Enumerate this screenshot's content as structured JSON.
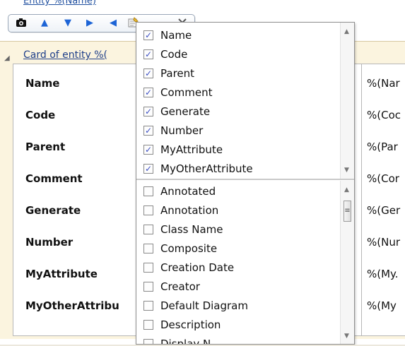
{
  "window": {
    "behind_title": "Entity %(Name)",
    "card_title": "Card of entity %("
  },
  "toolbar": {
    "icons": [
      "camera-icon",
      "arrow-up-icon",
      "arrow-down-icon",
      "arrow-right-icon",
      "arrow-left-icon",
      "properties-icon",
      "close-icon"
    ]
  },
  "card": {
    "rows": [
      {
        "label": "Name",
        "value": "%(Nar"
      },
      {
        "label": "Code",
        "value": "%(Coc"
      },
      {
        "label": "Parent",
        "value": "%(Par"
      },
      {
        "label": "Comment",
        "value": "%(Cor"
      },
      {
        "label": "Generate",
        "value": "%(Ger"
      },
      {
        "label": "Number",
        "value": "%(Nur"
      },
      {
        "label": "MyAttribute",
        "value": "%(My."
      },
      {
        "label": "MyOtherAttribu",
        "value": "%(My"
      }
    ]
  },
  "dropdown": {
    "top_items": [
      {
        "label": "Name",
        "checked": true
      },
      {
        "label": "Code",
        "checked": true
      },
      {
        "label": "Parent",
        "checked": true
      },
      {
        "label": "Comment",
        "checked": true
      },
      {
        "label": "Generate",
        "checked": true
      },
      {
        "label": "Number",
        "checked": true
      },
      {
        "label": "MyAttribute",
        "checked": true
      },
      {
        "label": "MyOtherAttribute",
        "checked": true
      }
    ],
    "bottom_items": [
      {
        "label": "Annotated",
        "checked": false
      },
      {
        "label": "Annotation",
        "checked": false
      },
      {
        "label": "Class Name",
        "checked": false
      },
      {
        "label": "Composite",
        "checked": false
      },
      {
        "label": "Creation Date",
        "checked": false
      },
      {
        "label": "Creator",
        "checked": false
      },
      {
        "label": "Default Diagram",
        "checked": false
      },
      {
        "label": "Description",
        "checked": false
      },
      {
        "label": "Display N",
        "checked": false
      }
    ]
  }
}
